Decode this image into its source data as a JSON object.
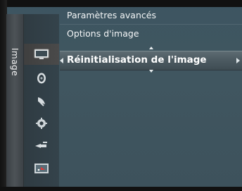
{
  "sidebar": {
    "category": "Image",
    "icons": [
      {
        "name": "tv-picture-icon",
        "selected": true
      },
      {
        "name": "sound-icon",
        "selected": false
      },
      {
        "name": "channel-icon",
        "selected": false
      },
      {
        "name": "setup-gear-icon",
        "selected": false
      },
      {
        "name": "input-icon",
        "selected": false
      },
      {
        "name": "application-icon",
        "selected": false
      }
    ]
  },
  "menu": {
    "items": [
      {
        "label": "Paramètres avancés"
      },
      {
        "label": "Options d'image"
      }
    ],
    "selected": {
      "label": "Réinitialisation de l'image"
    }
  },
  "colors": {
    "background": "#405660",
    "selected_bar": "#4d5b62",
    "text": "#f4f6f7"
  }
}
